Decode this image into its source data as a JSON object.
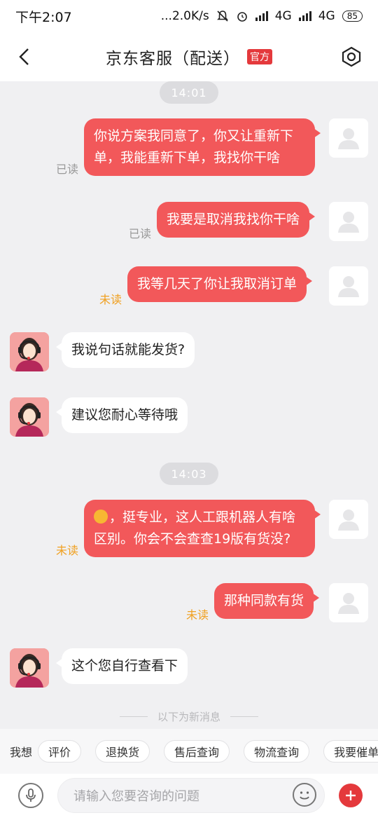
{
  "status_bar": {
    "time": "下午2:07",
    "speed": "...2.0K/s",
    "net1": "4G",
    "net2": "4G",
    "battery": "85"
  },
  "header": {
    "title": "京东客服（配送）",
    "badge": "官方"
  },
  "messages": [
    {
      "type": "time",
      "text": "14:01"
    },
    {
      "type": "out",
      "text": "你说方案我同意了，你又让重新下单，我能重新下单，我找你干啥",
      "status": "已读"
    },
    {
      "type": "out",
      "text": "我要是取消我找你干啥",
      "status": "已读"
    },
    {
      "type": "out",
      "text": "我等几天了你让我取消订单",
      "status": "未读"
    },
    {
      "type": "in",
      "text": "我说句话就能发货?"
    },
    {
      "type": "in",
      "text": "建议您耐心等待哦"
    },
    {
      "type": "time",
      "text": "14:03"
    },
    {
      "type": "out",
      "text": "，挺专业，这人工跟机器人有啥区别。你会不会查查19版有货没?",
      "emoji": "ok-hand",
      "status": "未读"
    },
    {
      "type": "out",
      "text": "那种同款有货",
      "status": "未读"
    },
    {
      "type": "in",
      "text": "这个您自行查看下"
    }
  ],
  "new_messages_divider": "以下为新消息",
  "quick_replies": {
    "label": "我想",
    "chips": [
      "评价",
      "退换货",
      "售后查询",
      "物流查询",
      "我要催单"
    ]
  },
  "input": {
    "placeholder": "请输入您要咨询的问题"
  },
  "colors": {
    "accent": "#e4393c",
    "bubble_out": "#f2585a",
    "unread": "#f0a020"
  }
}
